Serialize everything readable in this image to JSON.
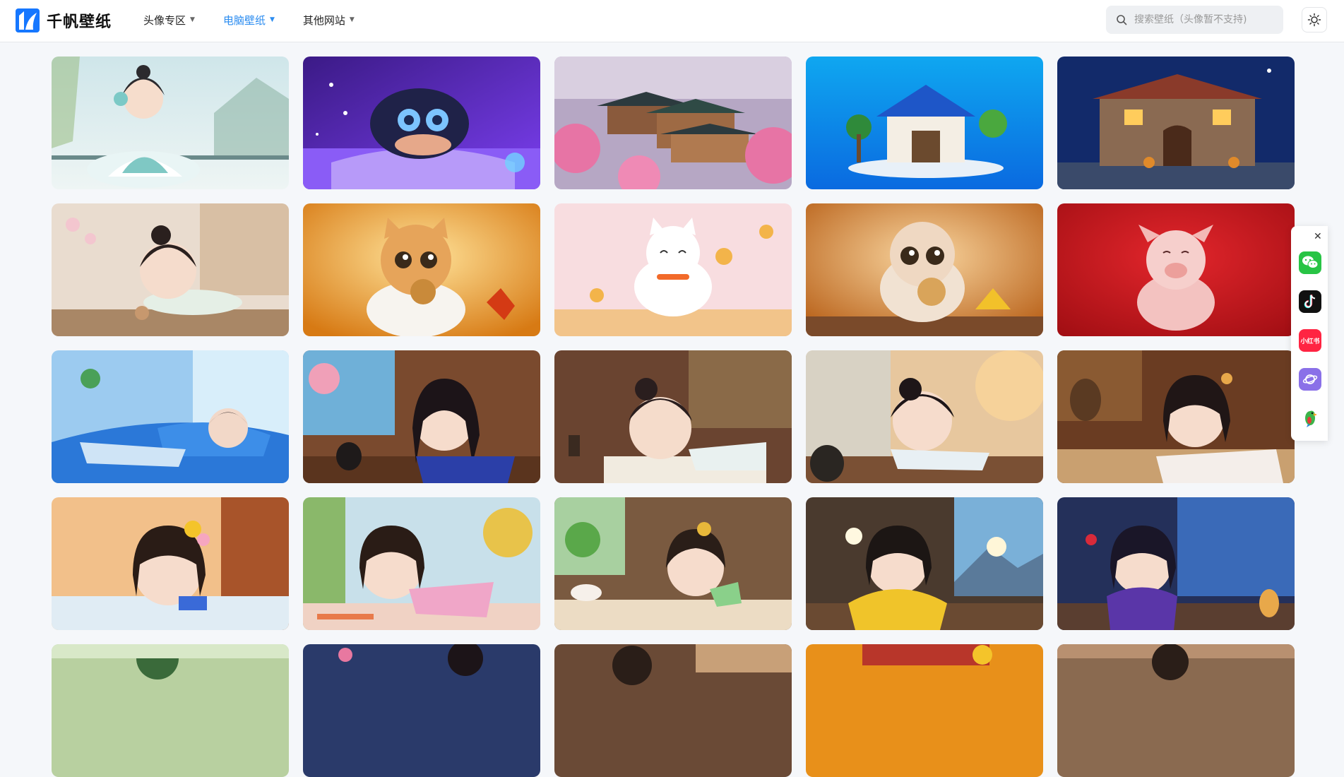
{
  "header": {
    "logo_text": "千帆壁纸",
    "nav": [
      {
        "label": "头像专区",
        "active": false
      },
      {
        "label": "电脑壁纸",
        "active": true
      },
      {
        "label": "其他网站",
        "active": false
      }
    ],
    "search_placeholder": "搜索壁纸（头像暂不支持)"
  },
  "colors": {
    "accent": "#2b8cf0",
    "background": "#f5f7fa"
  },
  "side_panel": {
    "close_glyph": "✕",
    "xiaohongshu_label": "小红书",
    "items": [
      "wechat-icon",
      "douyin-icon",
      "xiaohongshu-icon",
      "planet-icon",
      "parrot-icon"
    ]
  },
  "gallery": {
    "rows_visible": 5,
    "columns": 5,
    "items": [
      {
        "scene": "girl meditating in white and teal robes by lake"
      },
      {
        "scene": "boy with glasses lying in bed, purple lights"
      },
      {
        "scene": "ancient chinese town with pink blossoms"
      },
      {
        "scene": "blue-roof house on small island, blue background"
      },
      {
        "scene": "stone cottage with lit windows at night"
      },
      {
        "scene": "girl sleeping on table by window with plum blossoms"
      },
      {
        "scene": "orange cat holding mooncake in autumn"
      },
      {
        "scene": "white lucky cat with gold coins"
      },
      {
        "scene": "fluffy kitten holding mooncake in autumn"
      },
      {
        "scene": "smiling pink pig on red background"
      },
      {
        "scene": "girl sleeping on blue pillow by window"
      },
      {
        "scene": "girl in blue robe sleeping at desk"
      },
      {
        "scene": "girl in hanfu sleeping on calligraphy scroll"
      },
      {
        "scene": "girl sleeping on desk with vase"
      },
      {
        "scene": "girl in white hanfu sleeping on scrolls"
      },
      {
        "scene": "girl with yellow flowers sleeping on desk"
      },
      {
        "scene": "girl in pink robe sleeping on desk"
      },
      {
        "scene": "girl sleeping while writing with brush"
      },
      {
        "scene": "girl in yellow robe drinking tea"
      },
      {
        "scene": "girl in purple robe resting chin on hand"
      },
      {
        "scene": "partially visible wallpaper"
      },
      {
        "scene": "partially visible wallpaper"
      },
      {
        "scene": "partially visible wallpaper"
      },
      {
        "scene": "partially visible wallpaper"
      },
      {
        "scene": "partially visible wallpaper"
      }
    ]
  }
}
